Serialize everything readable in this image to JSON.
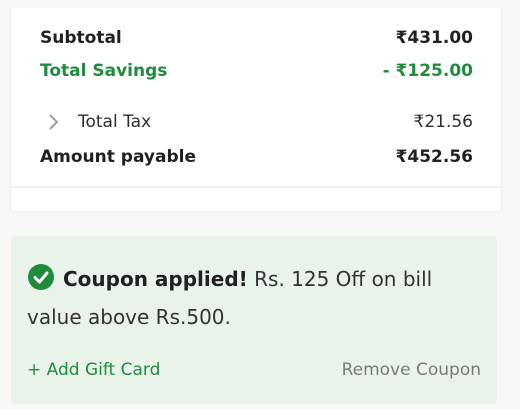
{
  "summary": {
    "subtotal_label": "Subtotal",
    "subtotal_value": "₹431.00",
    "savings_label": "Total Savings",
    "savings_value": "- ₹125.00",
    "tax_label": "Total Tax",
    "tax_value": "₹21.56",
    "payable_label": "Amount payable",
    "payable_value": "₹452.56"
  },
  "coupon": {
    "title": "Coupon applied!",
    "message": " Rs. 125 Off on bill value above Rs.500.",
    "add_gift_card": "+ Add Gift Card",
    "remove_coupon": "Remove Coupon"
  },
  "colors": {
    "accent_green": "#1f8b3c",
    "coupon_bg": "#e9f3ea"
  },
  "icons": {
    "tax_expand": "chevron-right-icon",
    "coupon_status": "check-circle-icon"
  }
}
